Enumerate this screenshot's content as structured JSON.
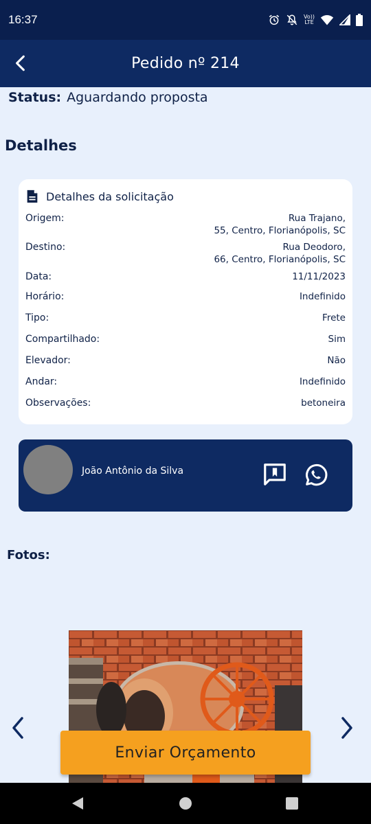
{
  "status_bar": {
    "time": "16:37",
    "icons": [
      "alarm-icon",
      "mute-icon",
      "volte-icon",
      "wifi-icon",
      "signal-icon",
      "battery-icon"
    ],
    "volte_top": "Vo))",
    "volte_bottom": "LTE"
  },
  "app_bar": {
    "title": "Pedido nº 214"
  },
  "status": {
    "label": "Status:",
    "value": "Aguardando proposta"
  },
  "details_section": {
    "title": "Detalhes"
  },
  "details_card": {
    "title": "Detalhes da solicitação",
    "rows": [
      {
        "key": "Origem:",
        "value_line1": "Rua Trajano,",
        "value_line2": "55, Centro, Florianópolis, SC"
      },
      {
        "key": "Destino:",
        "value_line1": "Rua Deodoro,",
        "value_line2": "66, Centro, Florianópolis, SC"
      },
      {
        "key": "Data:",
        "value": "11/11/2023"
      },
      {
        "key": "Horário:",
        "value": "Indefinido"
      },
      {
        "key": "Tipo:",
        "value": "Frete"
      },
      {
        "key": "Compartilhado:",
        "value": "Sim"
      },
      {
        "key": "Elevador:",
        "value": "Não"
      },
      {
        "key": "Andar:",
        "value": "Indefinido"
      },
      {
        "key": "Observações:",
        "value": "betoneira"
      }
    ]
  },
  "contact": {
    "name": "João Antônio da Silva"
  },
  "photos": {
    "title": "Fotos:"
  },
  "actions": {
    "send_quote": "Enviar Orçamento"
  },
  "colors": {
    "background": "#e8f0fc",
    "primary_dark": "#0e2a62",
    "accent": "#f5a01f"
  }
}
